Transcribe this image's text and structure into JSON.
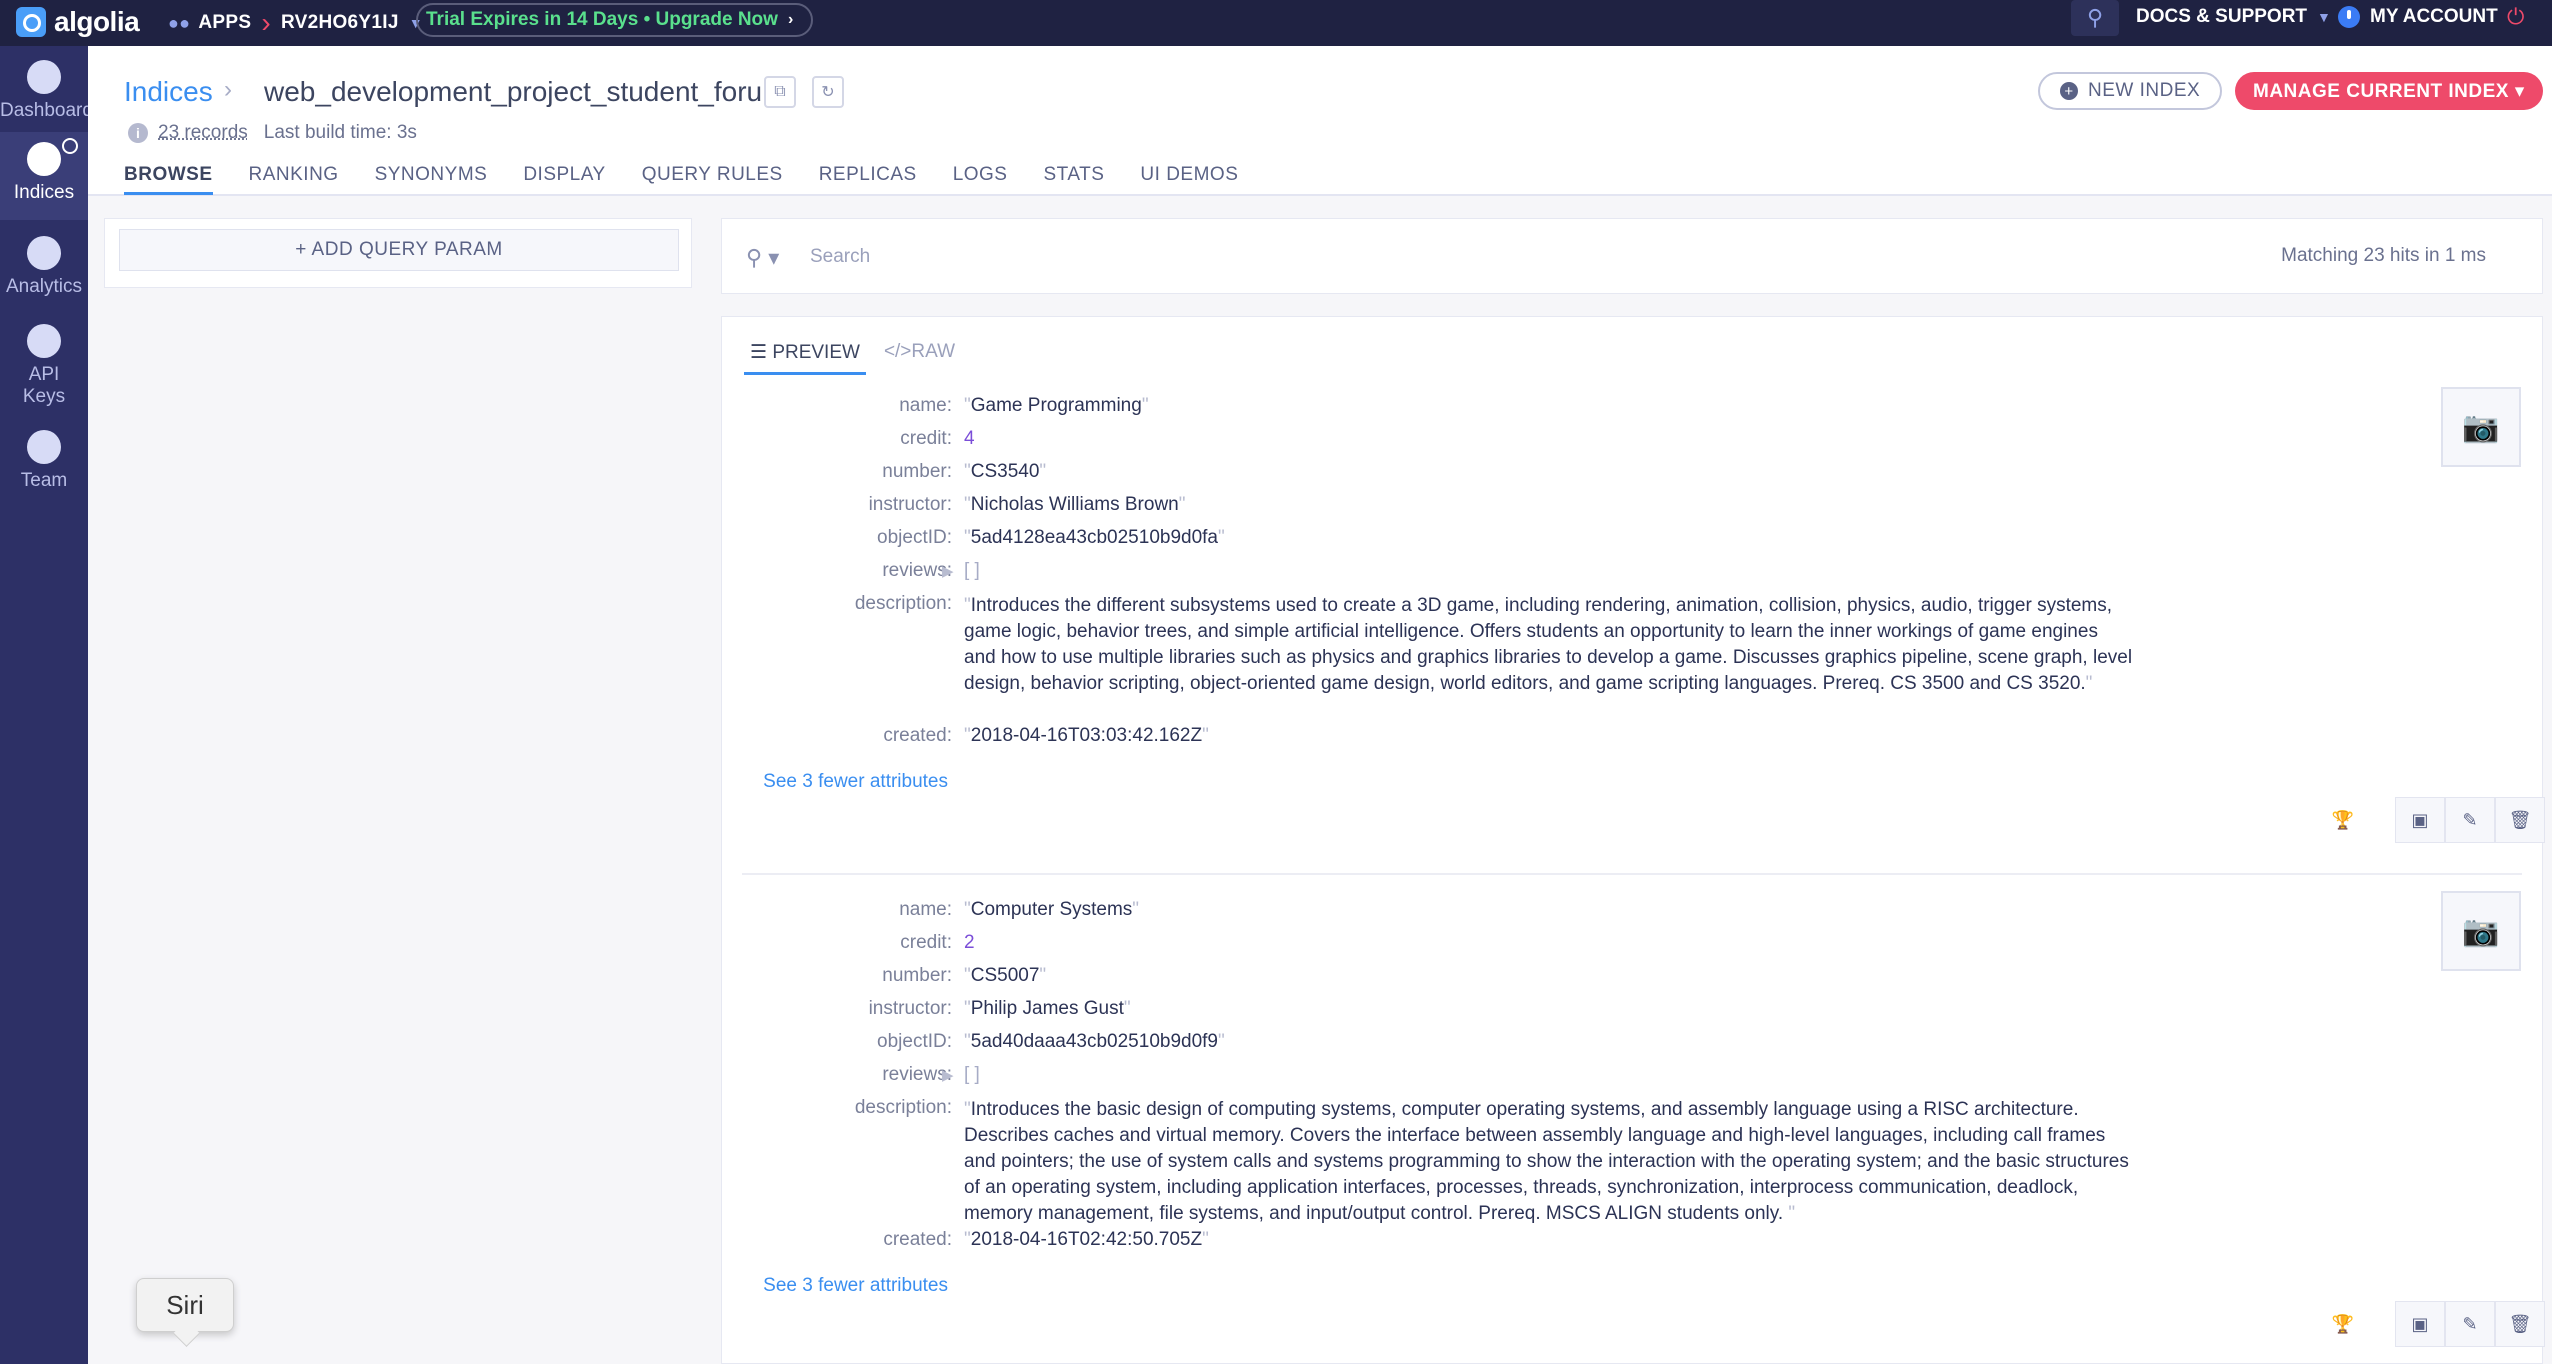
{
  "topbar": {
    "logo": "algolia",
    "apps_label": "APPS",
    "app_id": "RV2HO6Y1IJ",
    "trial_text": "Trial Expires in 14 Days • Upgrade Now",
    "docs_label": "DOCS & SUPPORT",
    "account_label": "MY ACCOUNT"
  },
  "leftnav": {
    "items": [
      {
        "label": "Dashboard",
        "icon": "speedometer-icon"
      },
      {
        "label": "Indices",
        "icon": "database-icon"
      },
      {
        "label": "Analytics",
        "icon": "bar-chart-icon"
      },
      {
        "label": "API Keys",
        "icon": "key-icon"
      },
      {
        "label": "Team",
        "icon": "team-icon"
      }
    ]
  },
  "header": {
    "breadcrumb_root": "Indices",
    "index_name": "web_development_project_student_forum",
    "records": "23 records",
    "last_build": "Last build time: 3s",
    "tabs": [
      "BROWSE",
      "RANKING",
      "SYNONYMS",
      "DISPLAY",
      "QUERY RULES",
      "REPLICAS",
      "LOGS",
      "STATS",
      "UI DEMOS"
    ],
    "new_index": "NEW INDEX",
    "manage_index": "MANAGE CURRENT INDEX ▾"
  },
  "query_param": {
    "label": "+ ADD QUERY PARAM"
  },
  "search": {
    "placeholder": "Search",
    "hits_text": "Matching 23 hits in 1 ms"
  },
  "view_tabs": {
    "preview": "PREVIEW",
    "raw": "RAW"
  },
  "hits": [
    {
      "name": "Game Programming",
      "credit": "4",
      "number": "CS3540",
      "instructor": "Nicholas Williams Brown",
      "objectID": "5ad4128ea43cb02510b9d0fa",
      "reviews": "[ ]",
      "description": "Introduces the different subsystems used to create a 3D game, including rendering, animation, collision, physics, audio, trigger systems, game logic, behavior trees, and simple artificial intelligence. Offers students an opportunity to learn the inner workings of game engines and how to use multiple libraries such as physics and graphics libraries to develop a game. Discusses graphics pipeline, scene graph, level design, behavior scripting, object-oriented game design, world editors, and game scripting languages. Prereq. CS 3500 and CS 3520.",
      "created": "2018-04-16T03:03:42.162Z",
      "fewer": "See 3 fewer attributes"
    },
    {
      "name": "Computer Systems",
      "credit": "2",
      "number": "CS5007",
      "instructor": "Philip James Gust",
      "objectID": "5ad40daaa43cb02510b9d0f9",
      "reviews": "[ ]",
      "description": "Introduces the basic design of computing systems, computer operating systems, and assembly language using a RISC architecture. Describes caches and virtual memory. Covers the interface between assembly language and high-level languages, including call frames and pointers; the use of system calls and systems programming to show the interaction with the operating system; and the basic structures of an operating system, including application interfaces, processes, threads, synchronization, interprocess communication, deadlock, memory management, file systems, and input/output control. Prereq. MSCS ALIGN students only. ",
      "created": "2018-04-16T02:42:50.705Z",
      "fewer": "See 3 fewer attributes"
    }
  ],
  "field_labels": {
    "name": "name:",
    "credit": "credit:",
    "number": "number:",
    "instructor": "instructor:",
    "objectID": "objectID:",
    "reviews": "reviews:",
    "description": "description:",
    "created": "created:"
  },
  "siri": {
    "label": "Siri"
  },
  "colors": {
    "topbar": "#1f2242",
    "sidebar": "#2d3066",
    "accent_blue": "#3a8ef0",
    "accent_pink": "#ee4a6a",
    "trial_green": "#5ae08d"
  }
}
